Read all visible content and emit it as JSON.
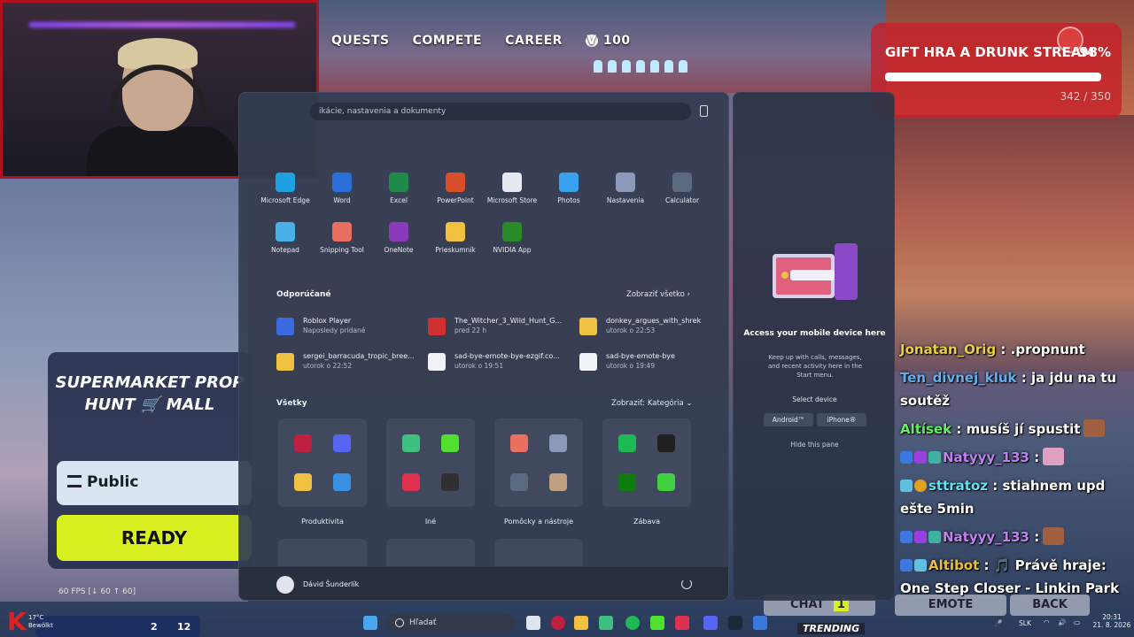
{
  "game": {
    "nav": [
      "QUESTS",
      "COMPETE",
      "CAREER"
    ],
    "vbucks": "100",
    "gift_title": "GIFT HRA A DRUNK STREAM",
    "gift_percent": "98%",
    "gift_count": "342 / 350",
    "gift_progress": 0.977,
    "panel_title": "SUPERMARKET PROP HUNT 🛒 MALL",
    "public_label": "Public",
    "ready_label": "READY",
    "fps": "60 FPS [↓ 60 ↑ 60]",
    "weather": "17°C\nBewölkt",
    "chat_button": "CHAT",
    "chat_count": "1",
    "emote_button": "EMOTE",
    "back_button": "BACK",
    "trending": "TRENDING",
    "bottom_left_nums": [
      "2",
      "12"
    ]
  },
  "start_menu": {
    "search_placeholder": "ikácie, nastavenia a dokumenty",
    "pinned": [
      {
        "label": "Microsoft Edge",
        "icon": "edge-icon",
        "color": "#1fa0e0"
      },
      {
        "label": "Word",
        "icon": "word-icon",
        "color": "#2b6fd8"
      },
      {
        "label": "Excel",
        "icon": "excel-icon",
        "color": "#1f8a4a"
      },
      {
        "label": "PowerPoint",
        "icon": "powerpoint-icon",
        "color": "#d8502a"
      },
      {
        "label": "Microsoft Store",
        "icon": "store-icon",
        "color": "#e8e8f0"
      },
      {
        "label": "Photos",
        "icon": "photos-icon",
        "color": "#3aa0f0"
      },
      {
        "label": "Nastavenia",
        "icon": "gear-icon",
        "color": "#8a9ab8"
      },
      {
        "label": "Calculator",
        "icon": "calculator-icon",
        "color": "#5a6a80"
      },
      {
        "label": "Notepad",
        "icon": "notepad-icon",
        "color": "#4ab0e8"
      },
      {
        "label": "Snipping Tool",
        "icon": "snipping-icon",
        "color": "#e87060"
      },
      {
        "label": "OneNote",
        "icon": "onenote-icon",
        "color": "#8a3ab8"
      },
      {
        "label": "Prieskumník",
        "icon": "folder-icon",
        "color": "#f0c040"
      },
      {
        "label": "NVIDIA App",
        "icon": "nvidia-icon",
        "color": "#2a8a2a"
      }
    ],
    "recommended_title": "Odporúčané",
    "recommended_link": "Zobraziť všetko",
    "recommended": [
      {
        "name": "Roblox Player",
        "sub": "Naposledy pridané",
        "icon": "roblox-icon",
        "color": "#3a6ae0"
      },
      {
        "name": "The_Witcher_3_Wild_Hunt_G...",
        "sub": "pred 22 h",
        "icon": "pdf-icon",
        "color": "#d03030"
      },
      {
        "name": "donkey_argues_with_shrek",
        "sub": "utorok o 22:53",
        "icon": "folder-icon",
        "color": "#f0c040"
      },
      {
        "name": "sergei_barracuda_tropic_bree...",
        "sub": "utorok o 22:52",
        "icon": "folder-icon",
        "color": "#f0c040"
      },
      {
        "name": "sad-bye-emote-bye-ezgif.co...",
        "sub": "utorok o 19:51",
        "icon": "file-icon",
        "color": "#f0f2f8"
      },
      {
        "name": "sad-bye-emote-bye",
        "sub": "utorok o 19:49",
        "icon": "file-icon",
        "color": "#f0f2f8"
      }
    ],
    "all_title": "Všetky",
    "all_link": "Zobraziť: Kategória",
    "folders": [
      {
        "label": "Produktivita",
        "icons": [
          "#c02040",
          "#5865f2",
          "#f0c040",
          "#3a90e0"
        ]
      },
      {
        "label": "Iné",
        "icons": [
          "#40c080",
          "#50e030",
          "#e03050",
          "#303030"
        ]
      },
      {
        "label": "Pomôcky a nástroje",
        "icons": [
          "#e87060",
          "#8a9ab8",
          "#5a6a80",
          "#c0a080"
        ]
      },
      {
        "label": "Zábava",
        "icons": [
          "#1db954",
          "#202020",
          "#107c10",
          "#40d040"
        ]
      }
    ],
    "user_name": "Dávid Šunderlík"
  },
  "phone_pane": {
    "title": "Access your mobile device here",
    "desc": "Keep up with calls, messages, and recent activity here in the Start menu.",
    "select": "Select device",
    "android": "Android™",
    "iphone": "iPhone®",
    "hide": "Hide this pane"
  },
  "chat": [
    {
      "user": "Jonatan_Orig",
      "msg": ": .propnunt",
      "color": "#e8d040"
    },
    {
      "user": "Ten_divnej_kluk",
      "msg": ": ja jdu na tu soutěž",
      "color": "#60b0f0"
    },
    {
      "user": "Altísek",
      "msg": ": musíš jí spustit",
      "color": "#60f060"
    },
    {
      "user": "Natyyy_133",
      "msg": ":",
      "color": "#c080f0"
    },
    {
      "user": "sttratoz",
      "msg": ": stiahnem upd ešte 5min",
      "color": "#60e0f0"
    },
    {
      "user": "Natyyy_133",
      "msg": ":",
      "color": "#c080f0"
    },
    {
      "user": "Altibot",
      "msg": ": 🎵 Právě hraje: One Step Closer - Linkin Park",
      "color": "#e8c040"
    }
  ],
  "taskbar": {
    "search": "Hľadať",
    "lang": "SLK",
    "time": "20:31",
    "date": "21. 8. 2026"
  }
}
